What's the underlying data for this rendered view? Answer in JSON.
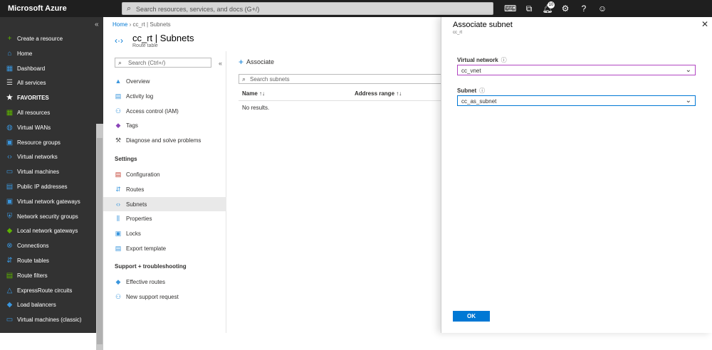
{
  "topbar": {
    "brand": "Microsoft Azure",
    "search_placeholder": "Search resources, services, and docs (G+/)",
    "notification_count": "10"
  },
  "leftnav": {
    "collapse": "«",
    "items": [
      {
        "label": "Create a resource",
        "icon": "plus-icon",
        "color": "#5db300"
      },
      {
        "label": "Home",
        "icon": "home-icon",
        "color": "#3a96dd"
      },
      {
        "label": "Dashboard",
        "icon": "dashboard-icon",
        "color": "#3a96dd"
      },
      {
        "label": "All services",
        "icon": "list-icon",
        "color": "#e0e0e0"
      },
      {
        "label": "FAVORITES",
        "icon": "star-icon",
        "color": "#fff"
      },
      {
        "label": "All resources",
        "icon": "grid-icon",
        "color": "#5db300"
      },
      {
        "label": "Virtual WANs",
        "icon": "globe-icon",
        "color": "#3a96dd"
      },
      {
        "label": "Resource groups",
        "icon": "cube-icon",
        "color": "#3a96dd"
      },
      {
        "label": "Virtual networks",
        "icon": "vnet-icon",
        "color": "#3a96dd"
      },
      {
        "label": "Virtual machines",
        "icon": "monitor-icon",
        "color": "#3a96dd"
      },
      {
        "label": "Public IP addresses",
        "icon": "ip-icon",
        "color": "#3a96dd"
      },
      {
        "label": "Virtual network gateways",
        "icon": "lock-icon",
        "color": "#3a96dd"
      },
      {
        "label": "Network security groups",
        "icon": "shield-icon",
        "color": "#3a96dd"
      },
      {
        "label": "Local network gateways",
        "icon": "diamond-icon",
        "color": "#5db300"
      },
      {
        "label": "Connections",
        "icon": "connection-icon",
        "color": "#3a96dd"
      },
      {
        "label": "Route tables",
        "icon": "route-icon",
        "color": "#3a96dd"
      },
      {
        "label": "Route filters",
        "icon": "filter-icon",
        "color": "#5db300"
      },
      {
        "label": "ExpressRoute circuits",
        "icon": "triangle-icon",
        "color": "#3a96dd"
      },
      {
        "label": "Load balancers",
        "icon": "diamond-icon",
        "color": "#3a96dd"
      },
      {
        "label": "Virtual machines (classic)",
        "icon": "monitor-icon",
        "color": "#3a96dd"
      }
    ]
  },
  "breadcrumb": {
    "home": "Home",
    "sep": " › ",
    "current": "cc_rt | Subnets"
  },
  "page": {
    "title": "cc_rt | Subnets",
    "subtitle": "Route table"
  },
  "menu": {
    "search_placeholder": "Search (Ctrl+/)",
    "collapse": "«",
    "items": [
      {
        "label": "Overview",
        "icon": "overview-icon",
        "color": "#3a96dd"
      },
      {
        "label": "Activity log",
        "icon": "activity-log-icon",
        "color": "#3a96dd"
      },
      {
        "label": "Access control (IAM)",
        "icon": "iam-icon",
        "color": "#3a96dd"
      },
      {
        "label": "Tags",
        "icon": "tag-icon",
        "color": "#8a44b8"
      },
      {
        "label": "Diagnose and solve problems",
        "icon": "wrench-icon",
        "color": "#555"
      }
    ],
    "settings_header": "Settings",
    "settings_items": [
      {
        "label": "Configuration",
        "icon": "config-icon",
        "color": "#c0392b"
      },
      {
        "label": "Routes",
        "icon": "route-icon",
        "color": "#3a96dd"
      },
      {
        "label": "Subnets",
        "icon": "subnet-icon",
        "color": "#3a96dd"
      },
      {
        "label": "Properties",
        "icon": "properties-icon",
        "color": "#3a96dd"
      },
      {
        "label": "Locks",
        "icon": "lock-icon",
        "color": "#3a96dd"
      },
      {
        "label": "Export template",
        "icon": "export-icon",
        "color": "#3a96dd"
      }
    ],
    "support_header": "Support + troubleshooting",
    "support_items": [
      {
        "label": "Effective routes",
        "icon": "effective-routes-icon",
        "color": "#3a96dd"
      },
      {
        "label": "New support request",
        "icon": "support-icon",
        "color": "#3a96dd"
      }
    ]
  },
  "content": {
    "associate": "Associate",
    "search_placeholder": "Search subnets",
    "columns": [
      "Name ↑↓",
      "Address range ↑↓"
    ],
    "empty": "No results."
  },
  "panel": {
    "title": "Associate subnet",
    "subtitle": "cc_rt",
    "vnet_label": "Virtual network",
    "vnet_value": "cc_vnet",
    "subnet_label": "Subnet",
    "subnet_value": "cc_as_subnet",
    "ok": "OK"
  }
}
